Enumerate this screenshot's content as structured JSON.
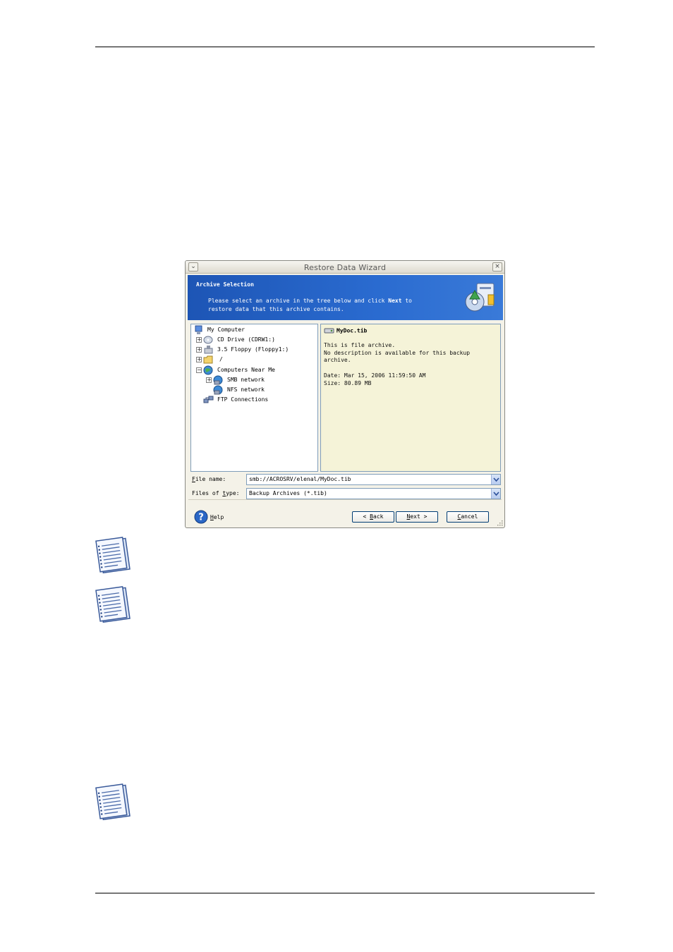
{
  "dialog": {
    "title": "Restore Data Wizard",
    "menu_glyph": "⌄",
    "close_glyph": "×",
    "banner": {
      "title": "Archive Selection",
      "desc_prefix": "Please select an archive in the tree below and click ",
      "desc_bold": "Next",
      "desc_suffix": " to",
      "desc_line2": "restore data that this archive contains."
    },
    "tree": [
      {
        "label": "My Computer",
        "icon": "computer-icon",
        "expander": ""
      },
      {
        "label": "CD Drive (CDRW1:)",
        "icon": "cd-drive-icon",
        "expander": "+"
      },
      {
        "label": "3.5 Floppy (Floppy1:)",
        "icon": "floppy-drive-icon",
        "expander": "+"
      },
      {
        "label": "/",
        "icon": "folder-icon",
        "expander": "+"
      },
      {
        "label": "Computers Near Me",
        "icon": "network-globe-icon",
        "expander": "−"
      },
      {
        "label": "SMB network",
        "icon": "smb-network-icon",
        "expander": "+"
      },
      {
        "label": "NFS network",
        "icon": "nfs-network-icon",
        "expander": ""
      },
      {
        "label": "FTP Connections",
        "icon": "ftp-connections-icon",
        "expander": ""
      }
    ],
    "info": {
      "filename": "MyDoc.tib",
      "line1": "This is file archive.",
      "line2": "No description is available for this backup",
      "line3": "archive.",
      "date": "Date: Mar 15, 2006 11:59:50 AM",
      "size": "Size: 80.89 MB"
    },
    "file_name_label_u": "F",
    "file_name_label_rest": "ile name:",
    "file_name_value": "smb://ACROSRV/elenal/MyDoc.tib",
    "file_type_label_pre": "Files of ",
    "file_type_label_u": "t",
    "file_type_label_rest": "ype:",
    "file_type_value": "Backup Archives (*.tib)",
    "help_u": "H",
    "help_rest": "elp",
    "back_pre": "< ",
    "back_u": "B",
    "back_rest": "ack",
    "next_u": "N",
    "next_rest": "ext >",
    "cancel_u": "C",
    "cancel_rest": "ancel"
  },
  "colors": {
    "banner_blue": "#1d55b5",
    "info_bg": "#f5f3d8",
    "dialog_bg": "#f4f2e8"
  }
}
